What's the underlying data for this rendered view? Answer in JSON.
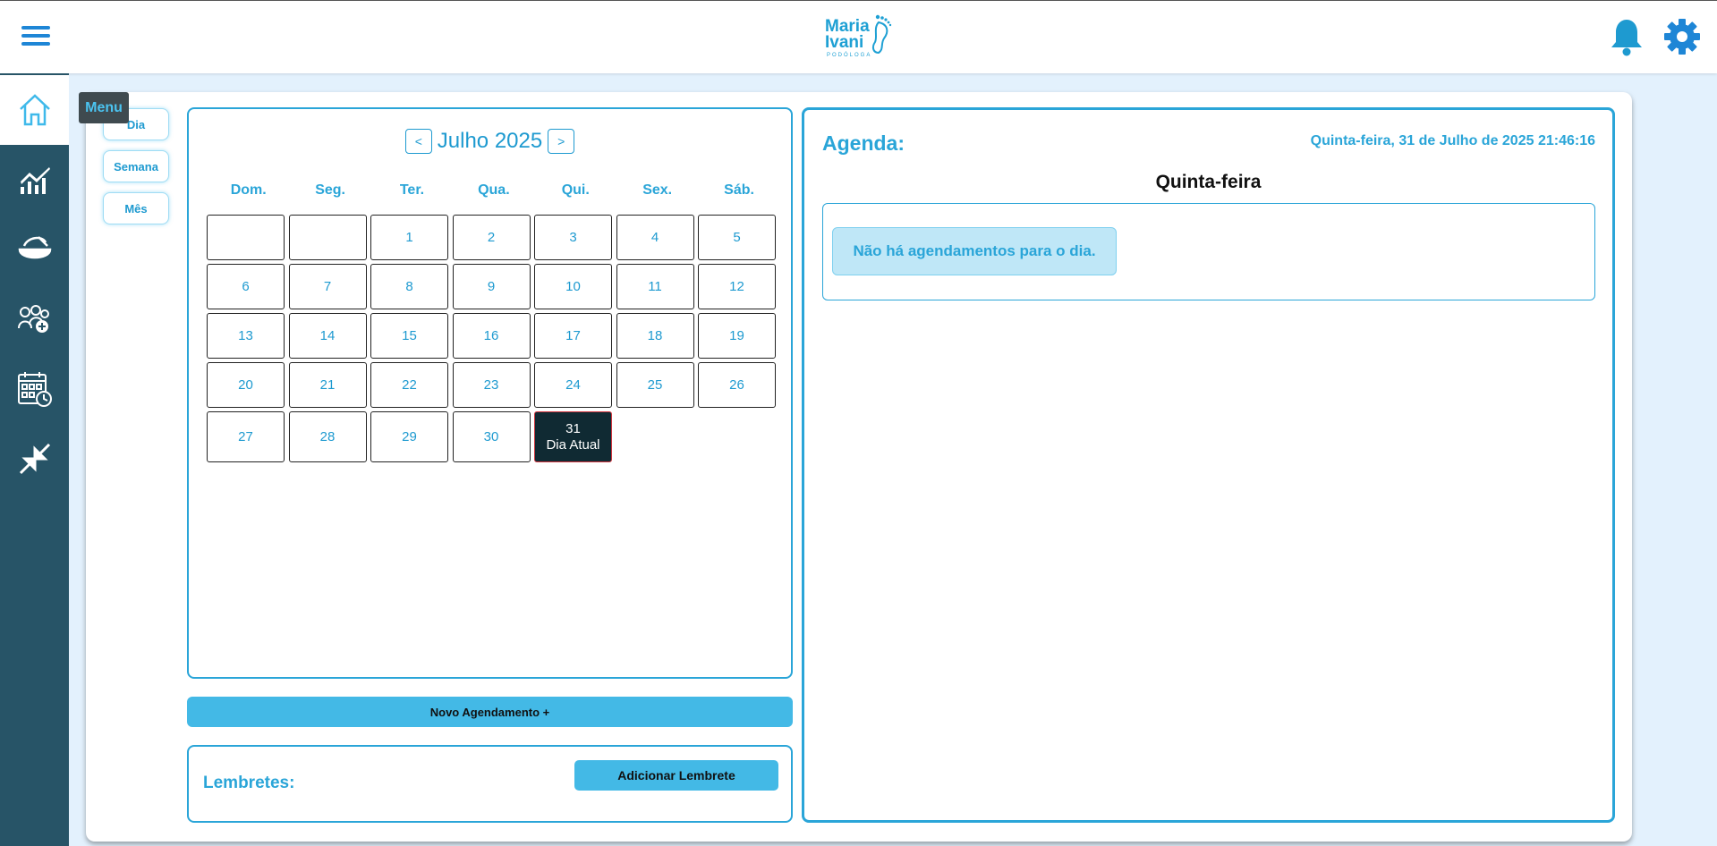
{
  "topbar": {
    "logo_line1": "Maria",
    "logo_line2": "Ivani",
    "logo_sub": "PODÓLOGA"
  },
  "sidebar": {
    "tooltip": "Menu",
    "items": [
      {
        "icon": "home-icon",
        "active": true
      },
      {
        "icon": "chart-icon"
      },
      {
        "icon": "foot-care-icon"
      },
      {
        "icon": "add-patients-icon"
      },
      {
        "icon": "calendar-clock-icon"
      },
      {
        "icon": "collapse-icon"
      }
    ]
  },
  "views": {
    "day": "Dia",
    "week": "Semana",
    "month": "Mês"
  },
  "calendar": {
    "prev": "<",
    "next": ">",
    "month_label": "Julho 2025",
    "weekdays": [
      "Dom.",
      "Seg.",
      "Ter.",
      "Qua.",
      "Qui.",
      "Sex.",
      "Sáb."
    ],
    "today_day": "31",
    "today_label": "Dia Atual"
  },
  "new_appointment": "Novo Agendamento +",
  "reminders": {
    "label": "Lembretes:",
    "add_button": "Adicionar Lembrete"
  },
  "agenda": {
    "title": "Agenda:",
    "datetime": "Quinta-feira, 31 de Julho de 2025 21:46:16",
    "weekday": "Quinta-feira",
    "empty_message": "Não há agendamentos para o dia."
  },
  "colors": {
    "accent": "#2aa5d8",
    "sidebar": "#275467",
    "today": "#102a33"
  }
}
